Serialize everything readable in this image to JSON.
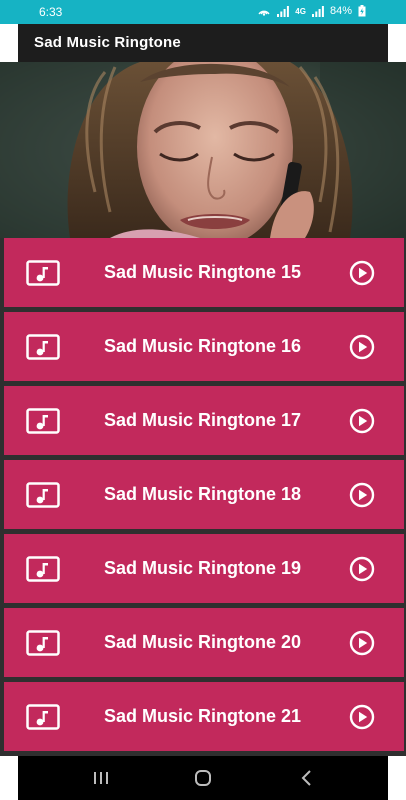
{
  "status_bar": {
    "time": "6:33",
    "network": "4G",
    "battery": "84%"
  },
  "app_bar": {
    "title": "Sad Music Ringtone"
  },
  "hero": {
    "image_name": "crying-woman-on-phone-photo"
  },
  "ringtones": [
    {
      "label": "Sad Music Ringtone 15"
    },
    {
      "label": "Sad Music Ringtone 16"
    },
    {
      "label": "Sad Music Ringtone 17"
    },
    {
      "label": "Sad Music Ringtone 18"
    },
    {
      "label": "Sad Music Ringtone 19"
    },
    {
      "label": "Sad Music Ringtone 20"
    },
    {
      "label": "Sad Music Ringtone 21"
    }
  ],
  "icons": {
    "item_left": "music-file-icon",
    "item_right": "play-circle-icon",
    "nav": [
      "recents-icon",
      "home-icon",
      "back-icon"
    ]
  },
  "colors": {
    "status_bar": "#16b3c4",
    "app_bar": "#1d1d1d",
    "item_background": "#c2295c",
    "list_gap": "#2f2f2f",
    "text": "#ffffff"
  }
}
